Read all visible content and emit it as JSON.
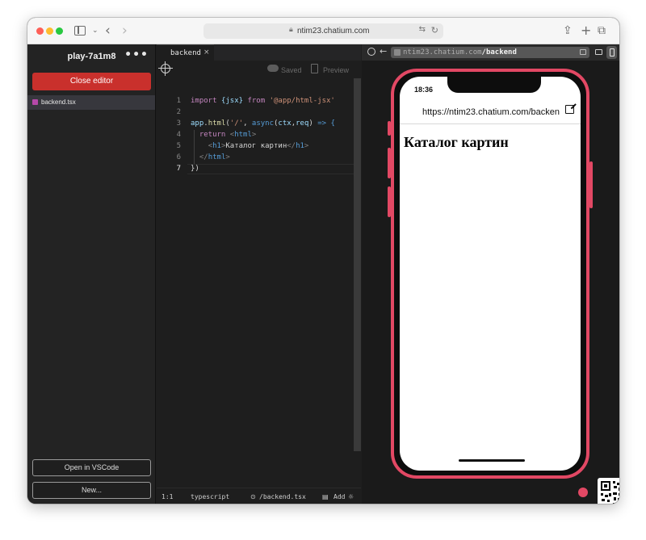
{
  "browser": {
    "address_url": "ntim23.chatium.com",
    "icons": [
      "sidebar-toggle-icon",
      "chevron-down-icon",
      "back-icon",
      "forward-icon",
      "lock-icon",
      "translate-icon",
      "reload-icon",
      "share-icon",
      "new-tab-icon",
      "tab-overview-icon"
    ]
  },
  "sidebar": {
    "project_title": "play-7a1m8",
    "more_label": "•••",
    "close_editor_label": "Close editor",
    "files": [
      {
        "name": "backend.tsx",
        "icon": "tsx-file-icon"
      }
    ],
    "open_vscode_label": "Open in VSCode",
    "new_label": "New..."
  },
  "editor": {
    "tab_label": "backend",
    "tab_close": "×",
    "saved_label": "Saved",
    "preview_label": "Preview",
    "line_numbers": [
      "1",
      "2",
      "3",
      "4",
      "5",
      "6",
      "7"
    ],
    "code": {
      "l1": {
        "kw": "import",
        "brace": "{jsx}",
        "from": "from",
        "str": "'@app/html-jsx'"
      },
      "l3": {
        "obj": "app",
        "dot": ".",
        "method": "html",
        "open": "(",
        "route": "'/'",
        "comma": ", ",
        "async": "async",
        "params_open": "(",
        "ctx": "ctx",
        "sep": ",",
        "req": "req",
        "params_close": ")",
        "arrow": " => {"
      },
      "l4": {
        "ret": "return",
        "open": "<",
        "tag": "html",
        "close": ">"
      },
      "l5": {
        "open": "<",
        "tag": "h1",
        "close": ">",
        "text": "Каталог картин",
        "end_open": "</",
        "end_tag": "h1",
        "end_close": ">"
      },
      "l6": {
        "open": "</",
        "tag": "html",
        "close": ">"
      },
      "l7": {
        "text": "})"
      }
    },
    "status": {
      "position": "1:1",
      "language": "typescript",
      "path": "/backend.tsx",
      "add": "Add"
    }
  },
  "preview": {
    "url_prefix": "ntim23.chatium.com",
    "url_path": "/backend",
    "phone": {
      "time": "18:36",
      "url": "https://ntim23.chatium.com/backen",
      "heading": "Каталог картин"
    }
  },
  "colors": {
    "accent_red": "#c9302c",
    "phone_frame": "#e24864",
    "editor_bg": "#1e1e1e"
  }
}
